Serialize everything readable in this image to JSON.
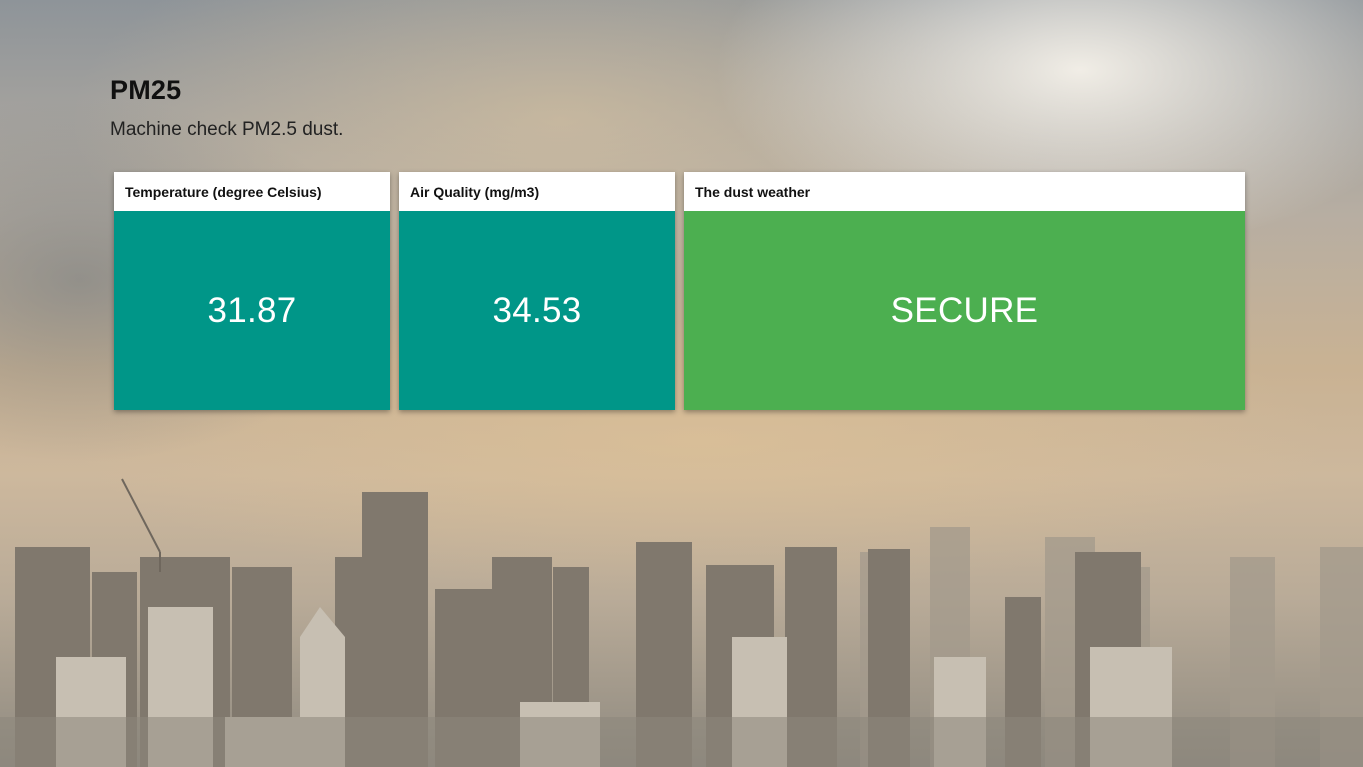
{
  "header": {
    "title": "PM25",
    "subtitle": "Machine check PM2.5 dust."
  },
  "cards": [
    {
      "label": "Temperature (degree Celsius)",
      "value": "31.87",
      "color": "#009688"
    },
    {
      "label": "Air Quality (mg/m3)",
      "value": "34.53",
      "color": "#009688"
    },
    {
      "label": "The dust weather",
      "value": "SECURE",
      "color": "#4caf50"
    }
  ]
}
